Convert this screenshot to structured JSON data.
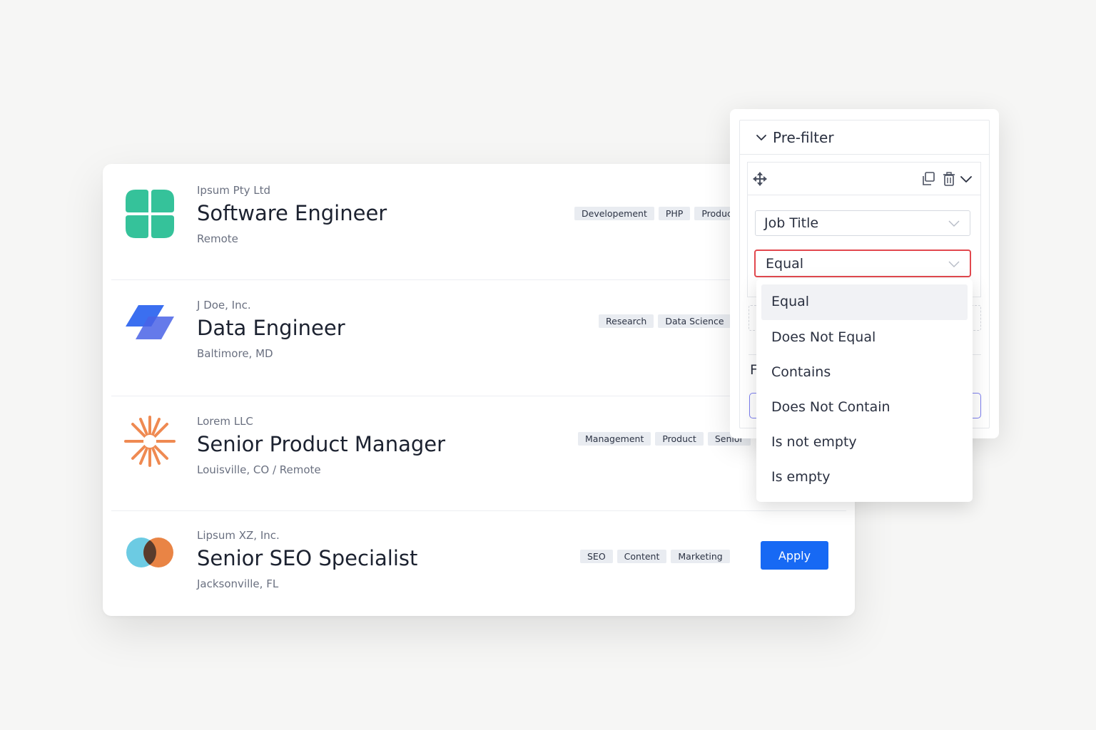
{
  "jobs": [
    {
      "company": "Ipsum Pty Ltd",
      "title": "Software Engineer",
      "location": "Remote",
      "tags": [
        "Developement",
        "PHP",
        "Product"
      ],
      "logo_icon": "clover-icon",
      "logo_color": "#35c29a"
    },
    {
      "company": "J Doe, Inc.",
      "title": "Data Engineer",
      "location": "Baltimore, MD",
      "tags": [
        "Research",
        "Data Science"
      ],
      "logo_icon": "parallelogram-icon",
      "logo_color": "#3b6ff0"
    },
    {
      "company": "Lorem LLC",
      "title": "Senior Product Manager",
      "location": "Louisville, CO / Remote",
      "tags": [
        "Management",
        "Product",
        "Senior"
      ],
      "logo_icon": "starburst-icon",
      "logo_color": "#ef8a52"
    },
    {
      "company": "Lipsum XZ, Inc.",
      "title": "Senior SEO Specialist",
      "location": "Jacksonville, FL",
      "tags": [
        "SEO",
        "Content",
        "Marketing"
      ],
      "logo_icon": "overlapping-circles-icon",
      "logo_color": "#e98445",
      "apply_label": "Apply"
    }
  ],
  "prefilter": {
    "title": "Pre-filter",
    "field_value": "Job Title",
    "operator_value": "Equal",
    "ghost_label": "F",
    "options": [
      "Equal",
      "Does Not Equal",
      "Contains",
      "Does Not Contain",
      "Is not empty",
      "Is empty"
    ],
    "selected_option": "Equal"
  },
  "colors": {
    "accent": "#1769f4",
    "error": "#e2484e"
  }
}
